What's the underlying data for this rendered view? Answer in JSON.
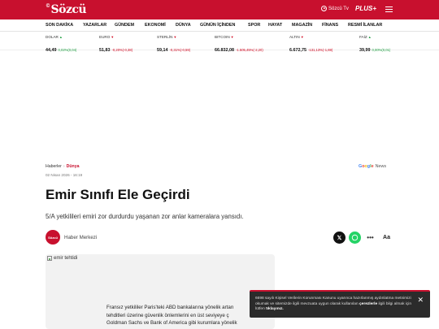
{
  "header": {
    "logo_small": "©",
    "logo_text": "Sözcü",
    "tv_label": "Sözcü Tv",
    "plus_label": "PLUS+",
    "brand_color": "#c8102e"
  },
  "nav": {
    "items": [
      "SON DAKİKA",
      "YAZARLAR",
      "GÜNDEM",
      "EKONOMİ",
      "DÜNYA",
      "GÜNÜN İÇİNDEN",
      "SPOR",
      "HAYAT",
      "MAGAZİN",
      "FİNANS",
      "RESMİ İLANLAR"
    ]
  },
  "ticker": [
    {
      "name": "DOLAR",
      "dir": "up",
      "value": "44,49",
      "change": "0,02%(0,04)"
    },
    {
      "name": "EURO",
      "dir": "down",
      "value": "51,83",
      "change": "-0,20%(-0,38)"
    },
    {
      "name": "STERLİN",
      "dir": "down",
      "value": "59,14",
      "change": "-0,31%(-0,59)"
    },
    {
      "name": "BITCOIN",
      "dir": "down",
      "value": "66.832,08",
      "change": "-1.505,45%(-2,20)"
    },
    {
      "name": "ALTIN",
      "dir": "down",
      "value": "6.672,75",
      "change": "-131,13%(-1,69)"
    },
    {
      "name": "FAİZ",
      "dir": "up",
      "value": "39,99",
      "change": "0,00%(0,01)"
    }
  ],
  "article": {
    "breadcrumb_home": "Haberler",
    "breadcrumb_sep": "›",
    "breadcrumb_section": "Dünya",
    "date": "02 Nisan 2026 - 16:19",
    "google_news_g": "Google",
    "google_news_label": "News",
    "title": "Emir Sınıfı Ele Geçirdi",
    "summary": "5/A yetkilileri emiri zor durdurdu yaşanan zor anlar kameralara yansıdı.",
    "author_logo": "Sözcü",
    "author": "Haber Merkezi",
    "share_x": "𝕏",
    "share_more": "•••",
    "share_font": "Aa",
    "image_alt": "emir tehtidi",
    "body_lines": [
      "Fransız yetkililer Paris'teki ABD bankalarına yönelik artan",
      "tehditleri üzerine güvenlik önlemlerini en üst seviyeye ç",
      "Goldman Sachs ve Bank of America gibi kurumlara yönelik"
    ]
  },
  "cookie": {
    "text_1": "6698 sayılı Kişisel Verilerin Korunması Kanunu uyarınca hazırlanmış aydınlatma metnimizi okumak ve sitemizde ilgili mevzuata uygun olarak kullanılan",
    "bold_1": "çerezlerle",
    "text_2": "ilgili bilgi almak için lütfen",
    "bold_2": "tıklayınız.",
    "close": "✕"
  }
}
